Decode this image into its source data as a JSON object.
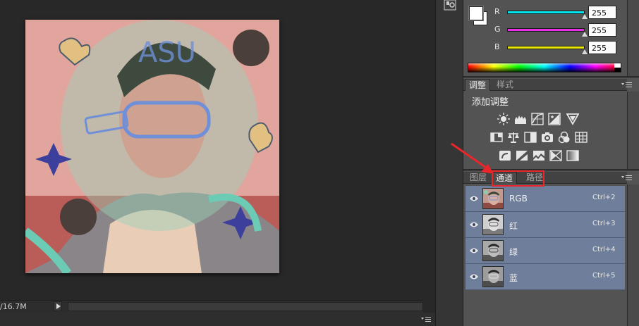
{
  "status": {
    "doc_size": "/16.7M"
  },
  "color_panel": {
    "sliders": [
      {
        "label": "R",
        "value": "255",
        "color": "#00e5ee"
      },
      {
        "label": "G",
        "value": "255",
        "color": "#e62ee6"
      },
      {
        "label": "B",
        "value": "255",
        "color": "#e8e800"
      }
    ]
  },
  "adjustments_panel": {
    "tabs": [
      "调整",
      "样式"
    ],
    "title": "添加调整",
    "icons": [
      "brightness-contrast-icon",
      "levels-icon",
      "curves-icon",
      "exposure-icon",
      "vibrance-icon",
      "hue-saturation-icon",
      "color-balance-icon",
      "black-white-icon",
      "photo-filter-icon",
      "channel-mixer-icon",
      "color-lookup-icon",
      "invert-icon",
      "posterize-icon",
      "threshold-icon",
      "selective-color-icon",
      "gradient-map-icon"
    ]
  },
  "channels_panel": {
    "tabs": [
      "图层",
      "通道",
      "路径"
    ],
    "active_tab": "通道",
    "rows": [
      {
        "name": "RGB",
        "shortcut": "Ctrl+2"
      },
      {
        "name": "红",
        "shortcut": "Ctrl+3"
      },
      {
        "name": "绿",
        "shortcut": "Ctrl+4"
      },
      {
        "name": "蓝",
        "shortcut": "Ctrl+5"
      }
    ]
  },
  "colors": {
    "selection_row": "#6e7e9b",
    "annotation_red": "#e8262b",
    "panel_bg": "#535353",
    "workspace_bg": "#282828"
  }
}
